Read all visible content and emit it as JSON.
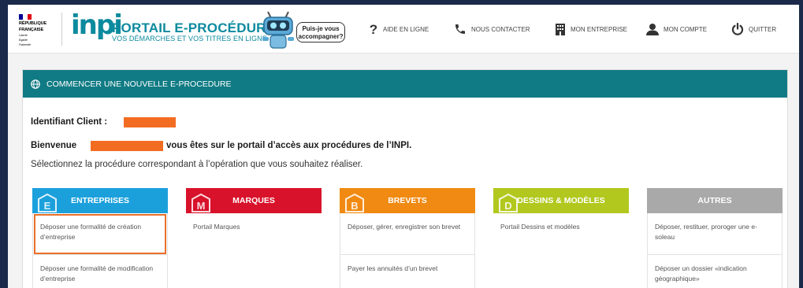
{
  "header": {
    "republique_line1": "RÉPUBLIQUE",
    "republique_line2": "FRANÇAISE",
    "devise_1": "Liberté",
    "devise_2": "Égalité",
    "devise_3": "Fraternité",
    "logo_text": "inpi",
    "portal_title": "PORTAIL E-PROCÉDURES",
    "portal_subtitle": "VOS DÉMARCHES ET VOS TITRES EN LIGNE",
    "assistant_bubble_1": "Puis-je vous",
    "assistant_bubble_2": "accompagner?",
    "nav": [
      {
        "label": "AIDE EN LIGNE",
        "icon": "question-icon"
      },
      {
        "label": "NOUS CONTACTER",
        "icon": "phone-icon"
      },
      {
        "label": "MON ENTREPRISE",
        "icon": "building-icon"
      },
      {
        "label": "MON COMPTE",
        "icon": "user-icon"
      },
      {
        "label": "QUITTER",
        "icon": "power-icon"
      }
    ]
  },
  "panel": {
    "title": "COMMENCER UNE NOUVELLE E-PROCEDURE",
    "client_id_label": "Identifiant Client :",
    "welcome_prefix": "Bienvenue",
    "welcome_suffix": "vous êtes sur le portail d’accès aux procédures de l’INPI.",
    "instruction": "Sélectionnez la procédure correspondant à l’opération que vous souhaitez réaliser."
  },
  "cards": [
    {
      "title": "ENTREPRISES",
      "letter": "E",
      "color": "#1ba0dc",
      "links": [
        "Déposer une formalité de création d’entreprise",
        "Déposer une formalité de modification d’entreprise"
      ]
    },
    {
      "title": "MARQUES",
      "letter": "M",
      "color": "#d8122a",
      "links": [
        "Portail Marques"
      ]
    },
    {
      "title": "BREVETS",
      "letter": "B",
      "color": "#f08a12",
      "links": [
        "Déposer, gérer, enregistrer son brevet",
        "Payer les annuités d’un brevet"
      ]
    },
    {
      "title": "DESSINS & MODÈLES",
      "letter": "D",
      "color": "#b2c81e",
      "links": [
        "Portail Dessins et modèles"
      ]
    },
    {
      "title": "AUTRES",
      "letter": "",
      "color": "#a9a9a9",
      "links": [
        "Déposer, restituer, proroger une e-soleau",
        "Déposer un dossier «indication géographique»"
      ]
    }
  ],
  "colors": {
    "accent": "#0c8a9e",
    "panel_header": "#107b84",
    "redaction": "#f26c22",
    "highlight": "#e8702a"
  }
}
